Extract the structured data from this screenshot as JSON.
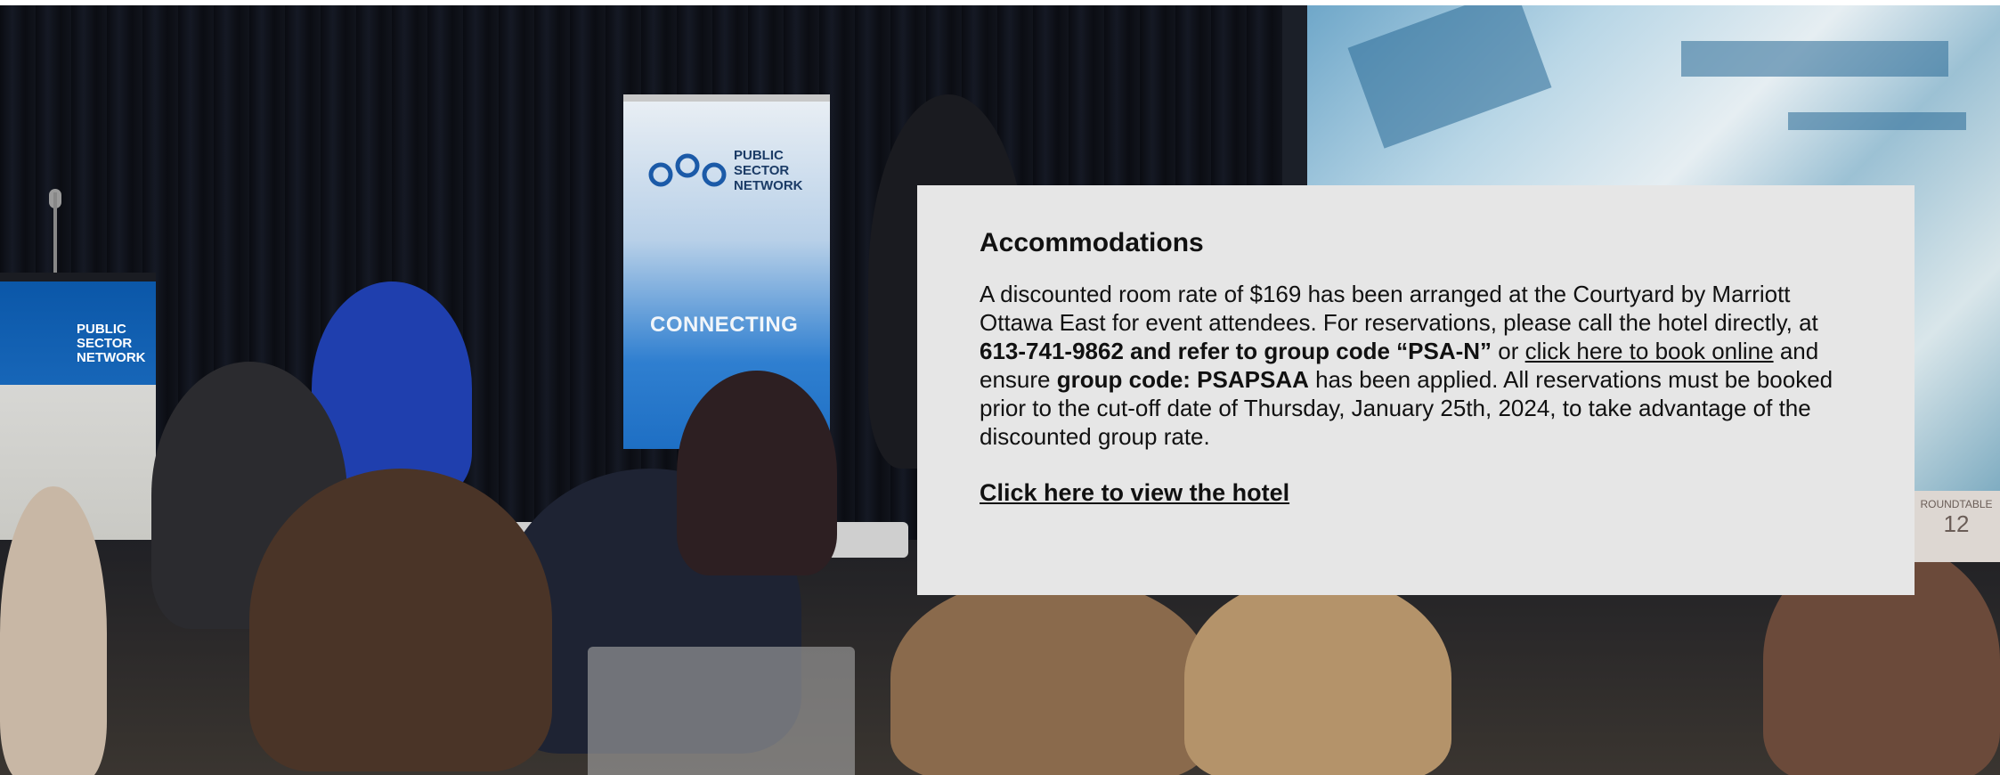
{
  "banner": {
    "podium_logo": [
      "PUBLIC",
      "SECTOR",
      "NETWORK"
    ],
    "standee_logo": [
      "PUBLIC",
      "SECTOR",
      "NETWORK"
    ],
    "standee_text": "CONNECTING",
    "roundtable_label": "ROUNDTABLE",
    "roundtable_number": "12"
  },
  "accommodations": {
    "title": "Accommodations",
    "p1": "A discounted room rate of $169 has been arranged at the Courtyard by Marriott Ottawa East for event attendees. For reservations, please call the hotel directly, at ",
    "phone_bold": "613-741-9862 and refer to group code “PSA-N”",
    "p2": " or ",
    "book_link": "click here to book online",
    "p3": " and ensure ",
    "group_code_bold": "group code: PSAPSAA",
    "p4": " has been applied.  All reservations must be booked prior to the cut-off date of Thursday, January 25th, 2024, to take advantage of the discounted group rate.",
    "view_hotel_link": "Click here to view the hotel"
  },
  "colors": {
    "card_bg": "#e6e6e6",
    "brand_blue": "#1766b8",
    "text": "#111111"
  }
}
